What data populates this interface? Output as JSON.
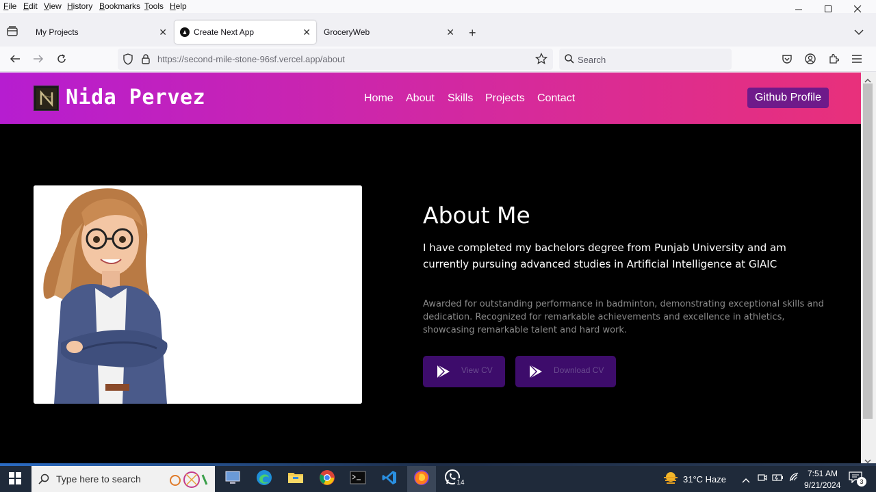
{
  "menubar": {
    "items": [
      "File",
      "Edit",
      "View",
      "History",
      "Bookmarks",
      "Tools",
      "Help"
    ]
  },
  "tabs": [
    {
      "label": "My Projects"
    },
    {
      "label": "Create Next App"
    },
    {
      "label": "GroceryWeb"
    }
  ],
  "navbar": {
    "url_host": "https://second-mile-stone-96sf.vercel.app",
    "url_path": "/about",
    "search_placeholder": "Search"
  },
  "site": {
    "brand": "Nida Pervez",
    "nav": [
      "Home",
      "About",
      "Skills",
      "Projects",
      "Contact"
    ],
    "github_label": "Github Profile",
    "about_title": "About Me",
    "about_lead": "I have completed my bachelors degree from Punjab University and am currently pursuing advanced studies in Artificial Intelligence at GIAIC",
    "about_sub": "Awarded for outstanding performance in badminton, demonstrating exceptional skills and dedication. Recognized for remarkable achievements and excellence in athletics, showcasing remarkable talent and hard work.",
    "view_cv": "View CV",
    "download_cv": "Download CV"
  },
  "taskbar": {
    "search_placeholder": "Type here to search",
    "weather": "31°C  Haze",
    "time": "7:51 AM",
    "date": "9/21/2024",
    "whatsapp_badge": "14",
    "notif_badge": "3"
  },
  "colors": {
    "header_start": "#b61dd0",
    "header_end": "#e8307b",
    "github_btn": "#6f1a8a",
    "cv_btn": "#3d0c6b"
  }
}
